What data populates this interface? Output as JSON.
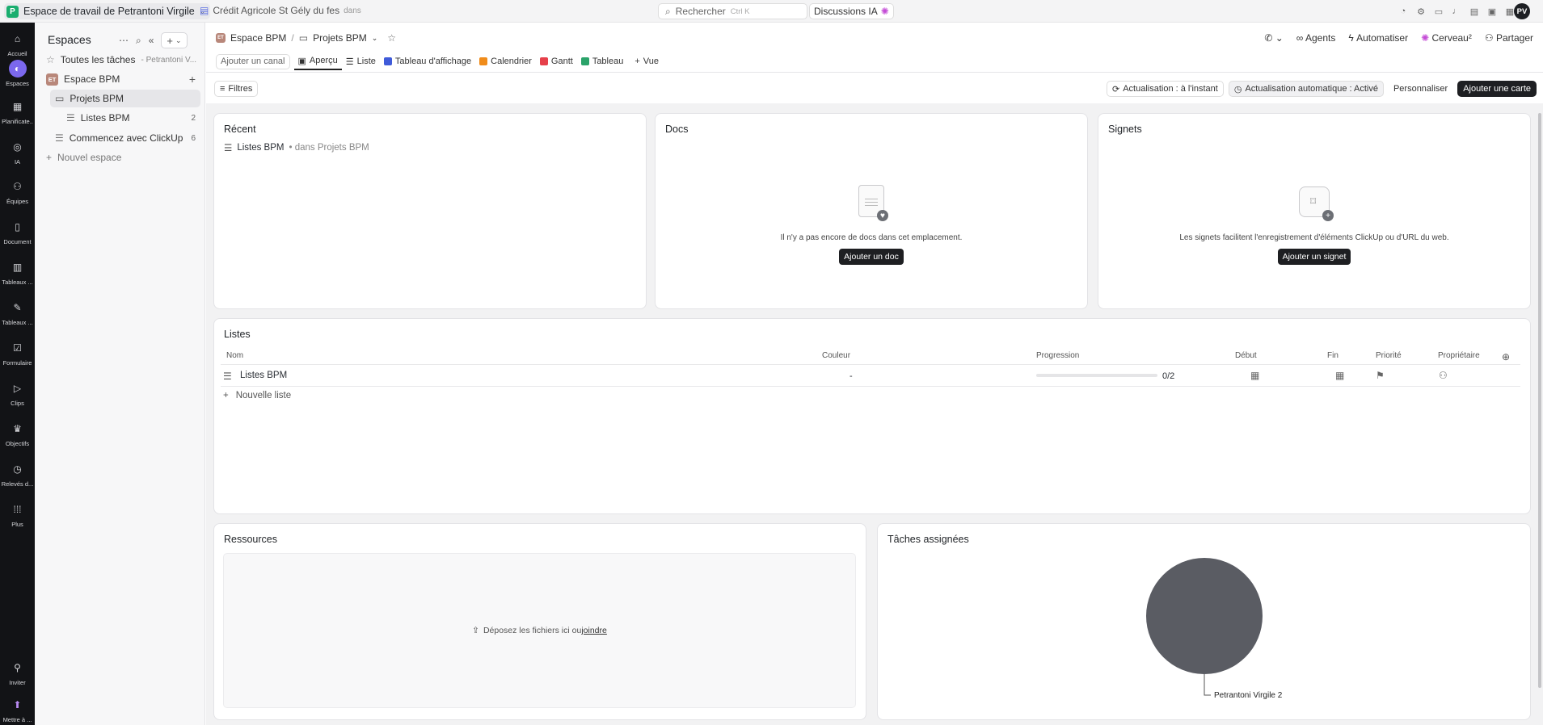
{
  "topbar": {
    "workspace_initial": "P",
    "workspace_name": "Espace de travail de Petrantoni Virgile",
    "recent_item": "Crédit Agricole St Gély du fes",
    "recent_suffix": "dans",
    "search_placeholder": "Rechercher",
    "search_shortcut": "Ctrl K",
    "ai_button": "Discussions IA",
    "avatar_initials": "PV"
  },
  "rail": {
    "items": [
      {
        "label": "Accueil",
        "icon": "home-icon"
      },
      {
        "label": "Espaces",
        "icon": "planet-icon"
      },
      {
        "label": "Planificate..",
        "icon": "calendar-icon"
      },
      {
        "label": "IA",
        "icon": "brain-icon"
      },
      {
        "label": "Équipes",
        "icon": "team-icon"
      },
      {
        "label": "Document",
        "icon": "document-icon"
      },
      {
        "label": "Tableaux ...",
        "icon": "dashboard-icon"
      },
      {
        "label": "Tableaux ...",
        "icon": "whiteboard-icon"
      },
      {
        "label": "Formulaire",
        "icon": "form-icon"
      },
      {
        "label": "Clips",
        "icon": "video-icon"
      },
      {
        "label": "Objectifs",
        "icon": "trophy-icon"
      },
      {
        "label": "Relevés d...",
        "icon": "clock-icon"
      },
      {
        "label": "Plus",
        "icon": "grid-icon"
      }
    ],
    "invite": "Inviter",
    "upgrade": "Mettre à ..."
  },
  "sidebar": {
    "title": "Espaces",
    "all_tasks": "Toutes les tâches",
    "all_tasks_owner": "- Petrantoni V...",
    "space_badge": "ET",
    "space_name": "Espace BPM",
    "folder": "Projets BPM",
    "list": "Listes BPM",
    "list_count": "2",
    "template": "Commencez avec ClickUp",
    "template_count": "6",
    "new_space": "Nouvel espace"
  },
  "header": {
    "badge": "ET",
    "space": "Espace BPM",
    "folder": "Projets BPM",
    "actions": {
      "agents": "Agents",
      "automate": "Automatiser",
      "brain": "Cerveau²",
      "share": "Partager"
    },
    "add_channel": "Ajouter un canal",
    "tabs": [
      "Aperçu",
      "Liste",
      "Tableau d'affichage",
      "Calendrier",
      "Gantt",
      "Tableau"
    ],
    "add_view": "Vue"
  },
  "toolbar": {
    "filters": "Filtres",
    "refresh": "Actualisation : à l'instant",
    "auto_refresh": "Actualisation automatique : Activé",
    "customize": "Personnaliser",
    "add_card": "Ajouter une carte"
  },
  "recent": {
    "title": "Récent",
    "item": "Listes BPM",
    "item_suffix": "• dans Projets BPM"
  },
  "docs": {
    "title": "Docs",
    "empty": "Il n'y a pas encore de docs dans cet emplacement.",
    "button": "Ajouter un doc"
  },
  "bookmarks": {
    "title": "Signets",
    "empty": "Les signets facilitent l'enregistrement d'éléments ClickUp ou d'URL du web.",
    "button": "Ajouter un signet"
  },
  "lists": {
    "title": "Listes",
    "columns": {
      "name": "Nom",
      "color": "Couleur",
      "progress": "Progression",
      "start": "Début",
      "end": "Fin",
      "priority": "Priorité",
      "owner": "Propriétaire"
    },
    "rows": [
      {
        "name": "Listes BPM",
        "color": "-",
        "progress_text": "0/2",
        "progress_fraction": 0
      }
    ],
    "new_list": "Nouvelle liste"
  },
  "resources": {
    "title": "Ressources",
    "drop_text": "Déposez les fichiers ici ou",
    "drop_link": "joindre"
  },
  "assigned": {
    "title": "Tâches assignées"
  },
  "chart_data": {
    "type": "pie",
    "series": [
      {
        "name": "Petrantoni Virgile 2",
        "values": [
          2
        ]
      }
    ],
    "categories": [
      "Petrantoni Virgile 2"
    ],
    "colors": [
      "#5a5c63"
    ]
  }
}
